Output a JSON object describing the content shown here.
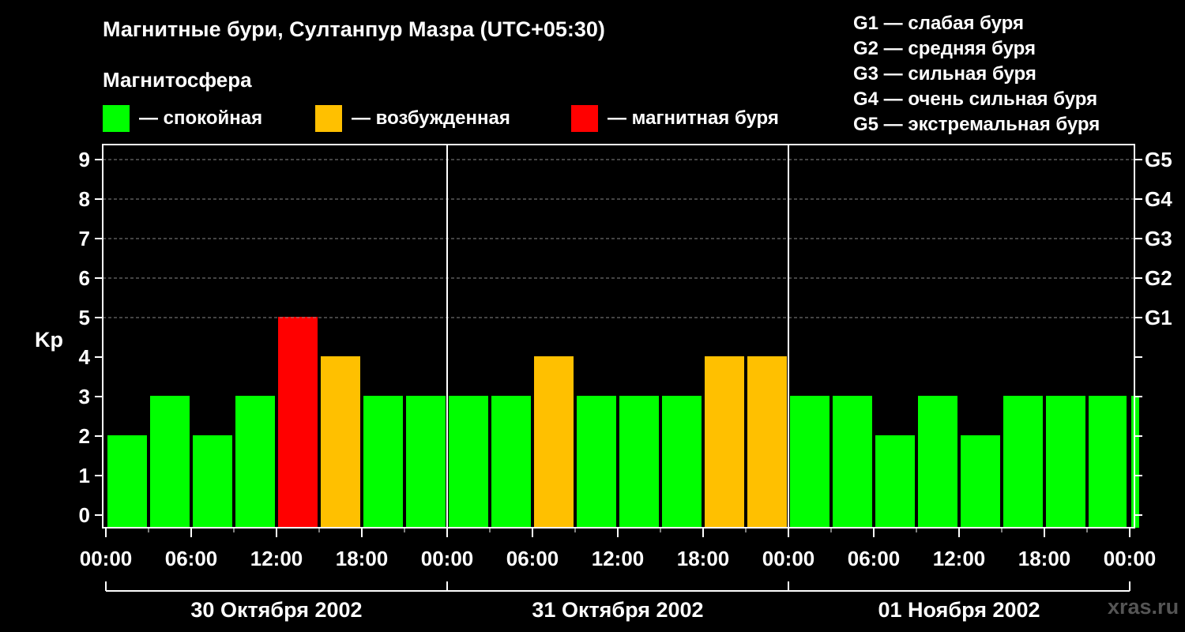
{
  "title": "Магнитные бури, Султанпур Мазра (UTC+05:30)",
  "subtitle": "Магнитосфера",
  "legend": [
    {
      "label": "— спокойная",
      "color": "#00ff00"
    },
    {
      "label": "— возбужденная",
      "color": "#ffc000"
    },
    {
      "label": "— магнитная буря",
      "color": "#ff0000"
    }
  ],
  "g_scale": [
    "G1 — слабая буря",
    "G2 — средняя буря",
    "G3 — сильная буря",
    "G4 — очень сильная буря",
    "G5 — экстремальная буря"
  ],
  "watermark": "xras.ru",
  "chart_data": {
    "type": "bar",
    "ylabel": "Kp",
    "ylim": [
      0,
      9
    ],
    "yticks": [
      "0",
      "1",
      "2",
      "3",
      "4",
      "5",
      "6",
      "7",
      "8",
      "9"
    ],
    "right_ticks": [
      {
        "value": 5,
        "label": "G1"
      },
      {
        "value": 6,
        "label": "G2"
      },
      {
        "value": 7,
        "label": "G3"
      },
      {
        "value": 8,
        "label": "G4"
      },
      {
        "value": 9,
        "label": "G5"
      }
    ],
    "grid": true,
    "xticks": [
      "00:00",
      "06:00",
      "12:00",
      "18:00",
      "00:00",
      "06:00",
      "12:00",
      "18:00",
      "00:00",
      "06:00",
      "12:00",
      "18:00",
      "00:00"
    ],
    "days": [
      "30 Октября 2002",
      "31 Октября 2002",
      "01 Ноября 2002"
    ],
    "interval_hours": 3,
    "values": [
      2,
      3,
      2,
      3,
      5,
      4,
      3,
      3,
      3,
      3,
      4,
      3,
      3,
      3,
      4,
      4,
      3,
      3,
      2,
      3,
      2,
      3,
      3,
      3,
      3
    ],
    "colors": {
      "quiet": "#00ff00",
      "active": "#ffc000",
      "storm": "#ff0000"
    }
  }
}
